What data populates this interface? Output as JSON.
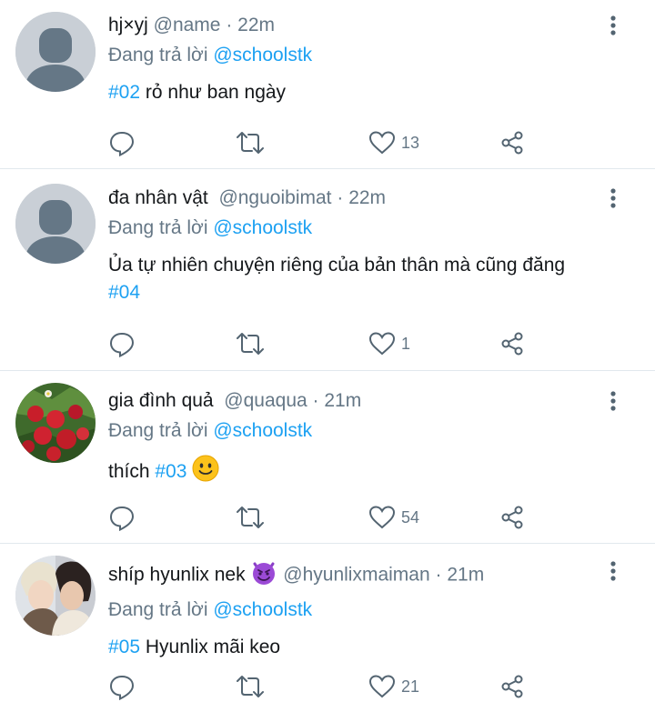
{
  "tweets": [
    {
      "display_name": "hj×yj",
      "handle": "@name",
      "dot": "·",
      "time": "22m",
      "replying_prefix": "Đang trả lời",
      "replying_to": "@schoolstk",
      "hashtag": "#02",
      "text_after": " rỏ như ban ngày",
      "likes": "13",
      "avatar": "default"
    },
    {
      "display_name": "đa nhân vật",
      "handle": "@nguoibimat",
      "dot": "·",
      "time": "22m",
      "replying_prefix": "Đang trả lời",
      "replying_to": "@schoolstk",
      "text_before": "Ủa tự nhiên chuyện riêng của bản thân mà cũng đăng",
      "hashtag": "#04",
      "likes": "1",
      "avatar": "default"
    },
    {
      "display_name": "gia đình quả",
      "handle": "@quaqua",
      "dot": "·",
      "time": "21m",
      "replying_prefix": "Đang trả lời",
      "replying_to": "@schoolstk",
      "text_before": "thích ",
      "hashtag": "#03",
      "emoji": "slightly-smiling-face-emoji",
      "likes": "54",
      "avatar": "strawberries-photo"
    },
    {
      "display_name": "shíp hyunlix nek",
      "name_emoji": "smiling-imp-emoji",
      "handle": "@hyunlixmaiman",
      "dot": "·",
      "time": "21m",
      "replying_prefix": "Đang trả lời",
      "replying_to": "@schoolstk",
      "hashtag": "#05",
      "text_after": " Hyunlix mãi keo",
      "likes": "21",
      "avatar": "two-people-photo"
    }
  ],
  "colors": {
    "link": "#1da1f2",
    "meta": "#657786",
    "text": "#14171a",
    "divider": "#e1e8ed"
  }
}
